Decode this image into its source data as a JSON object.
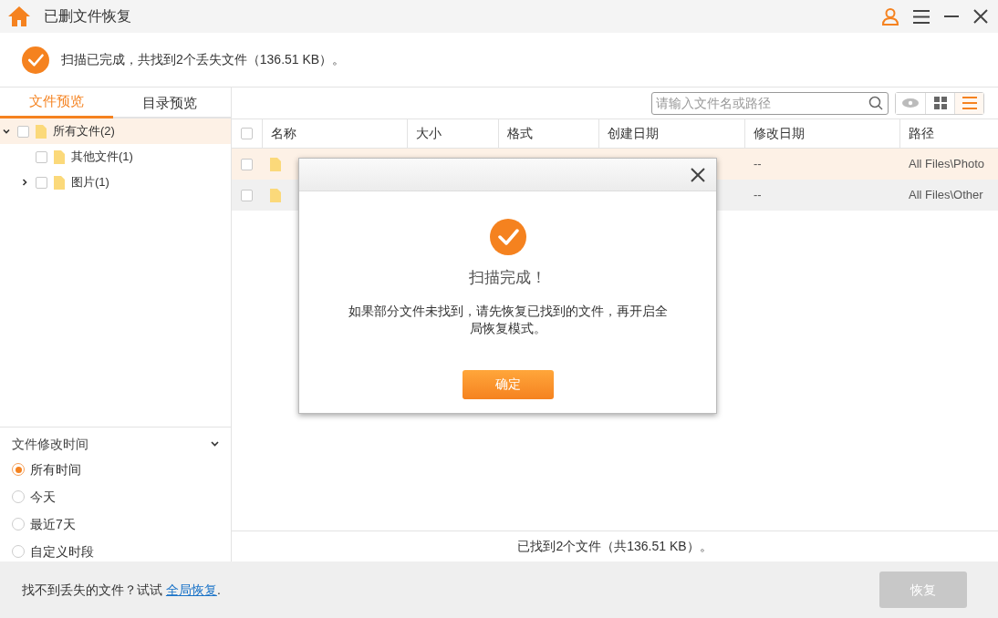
{
  "window": {
    "title": "已删文件恢复"
  },
  "scan_status": {
    "message": "扫描已完成，共找到2个丢失文件（136.51 KB）。"
  },
  "left_tabs": [
    {
      "label": "文件预览",
      "selected": true
    },
    {
      "label": "目录预览",
      "selected": false
    }
  ],
  "tree": [
    {
      "label": "所有文件(2)",
      "checked": false,
      "expanded": true,
      "selected": true,
      "children": [
        {
          "label": "其他文件(1)",
          "checked": false,
          "selected": false
        },
        {
          "label": "图片(1)",
          "checked": false,
          "expanded": false,
          "selected": false
        }
      ]
    }
  ],
  "filter": {
    "title": "文件修改时间",
    "options": [
      {
        "label": "所有时间",
        "selected": true
      },
      {
        "label": "今天",
        "selected": false
      },
      {
        "label": "最近7天",
        "selected": false
      },
      {
        "label": "自定义时段",
        "selected": false
      }
    ]
  },
  "search": {
    "placeholder": "请输入文件名或路径"
  },
  "view_buttons": [
    {
      "kind": "preview",
      "selected": false
    },
    {
      "kind": "grid",
      "selected": false
    },
    {
      "kind": "list",
      "selected": true
    }
  ],
  "table": {
    "select_all_checked": false,
    "columns": [
      "名称",
      "大小",
      "格式",
      "创建日期",
      "修改日期",
      "路径"
    ],
    "rows": [
      {
        "modified": "--",
        "path": "All Files\\Photo",
        "checked": false,
        "selected": true
      },
      {
        "modified": "--",
        "path": "All Files\\Other",
        "checked": false,
        "selected": false
      }
    ]
  },
  "summary": "已找到2个文件（共136.51 KB）。",
  "footer": {
    "prompt": "找不到丢失的文件？试试",
    "link": "全局恢复",
    "suffix": ".",
    "recover_button": {
      "label": "恢复",
      "disabled": true
    }
  },
  "dialog": {
    "title": "扫描完成！",
    "message": "如果部分文件未找到，请先恢复已找到的文件，再开启全局恢复模式。",
    "button": "确定"
  }
}
